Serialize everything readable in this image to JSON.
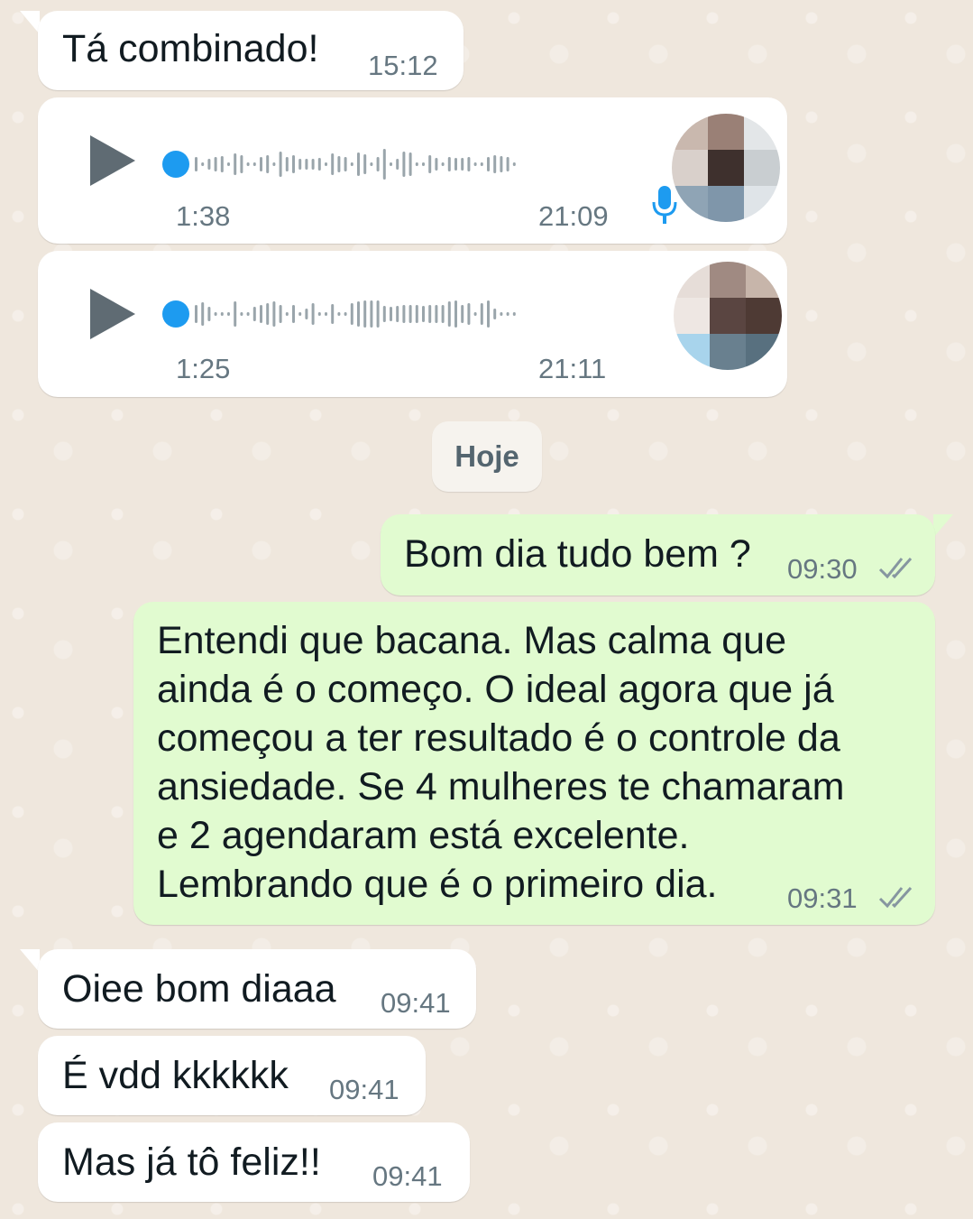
{
  "messages": [
    {
      "text": "Tá combinado!",
      "time": "15:12"
    },
    {
      "duration": "1:38",
      "time": "21:09"
    },
    {
      "duration": "1:25",
      "time": "21:11"
    },
    {
      "date": "Hoje"
    },
    {
      "text": "Bom dia tudo bem ?",
      "time": "09:30"
    },
    {
      "text": "Entendi que bacana. Mas calma que\nainda é o começo. O ideal agora que já\ncomeçou a ter resultado é o controle da\nansiedade. Se 4 mulheres te chamaram\ne 2 agendaram está excelente.\nLembrando que é o primeiro dia.",
      "time": "09:31"
    },
    {
      "text": "Oiee bom diaaa",
      "time": "09:41"
    },
    {
      "text": "É vdd kkkkkk",
      "time": "09:41"
    },
    {
      "text": "Mas já tô feliz!!",
      "time": "09:41"
    }
  ],
  "colors": {
    "incoming_bubble": "#ffffff",
    "outgoing_bubble": "#e1fbd0",
    "voice_accent": "#1d9bf0",
    "read_ticks": "#8696a0"
  }
}
